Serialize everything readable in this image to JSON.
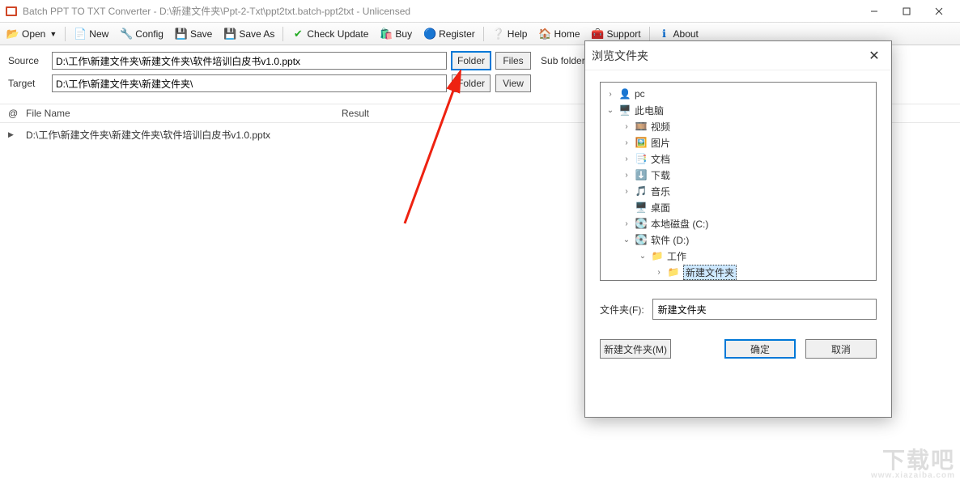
{
  "window": {
    "title": "Batch PPT TO TXT Converter - D:\\新建文件夹\\Ppt-2-Txt\\ppt2txt.batch-ppt2txt - Unlicensed"
  },
  "toolbar": {
    "open": "Open",
    "new": "New",
    "config": "Config",
    "save": "Save",
    "saveas": "Save As",
    "check": "Check Update",
    "buy": "Buy",
    "register": "Register",
    "help": "Help",
    "home": "Home",
    "support": "Support",
    "about": "About"
  },
  "paths": {
    "source_label": "Source",
    "source_value": "D:\\工作\\新建文件夹\\新建文件夹\\软件培训白皮书v1.0.pptx",
    "target_label": "Target",
    "target_value": "D:\\工作\\新建文件夹\\新建文件夹\\",
    "folder_btn": "Folder",
    "files_btn": "Files",
    "view_btn": "View",
    "subfolders_label": "Sub folders"
  },
  "list": {
    "col_at": "@",
    "col_filename": "File Name",
    "col_result": "Result",
    "row0_name": "D:\\工作\\新建文件夹\\新建文件夹\\软件培训白皮书v1.0.pptx"
  },
  "dialog": {
    "title": "浏览文件夹",
    "tree": {
      "pc": "pc",
      "this_pc": "此电脑",
      "video": "视频",
      "pictures": "图片",
      "documents": "文档",
      "downloads": "下载",
      "music": "音乐",
      "desktop": "桌面",
      "drive_c": "本地磁盘 (C:)",
      "drive_d": "软件 (D:)",
      "work": "工作",
      "newfolder": "新建文件夹"
    },
    "field_label": "文件夹(F):",
    "field_value": "新建文件夹",
    "btn_new": "新建文件夹(M)",
    "btn_ok": "确定",
    "btn_cancel": "取消"
  },
  "watermark": {
    "big": "下载吧",
    "small": "www.xiazaiba.com"
  }
}
